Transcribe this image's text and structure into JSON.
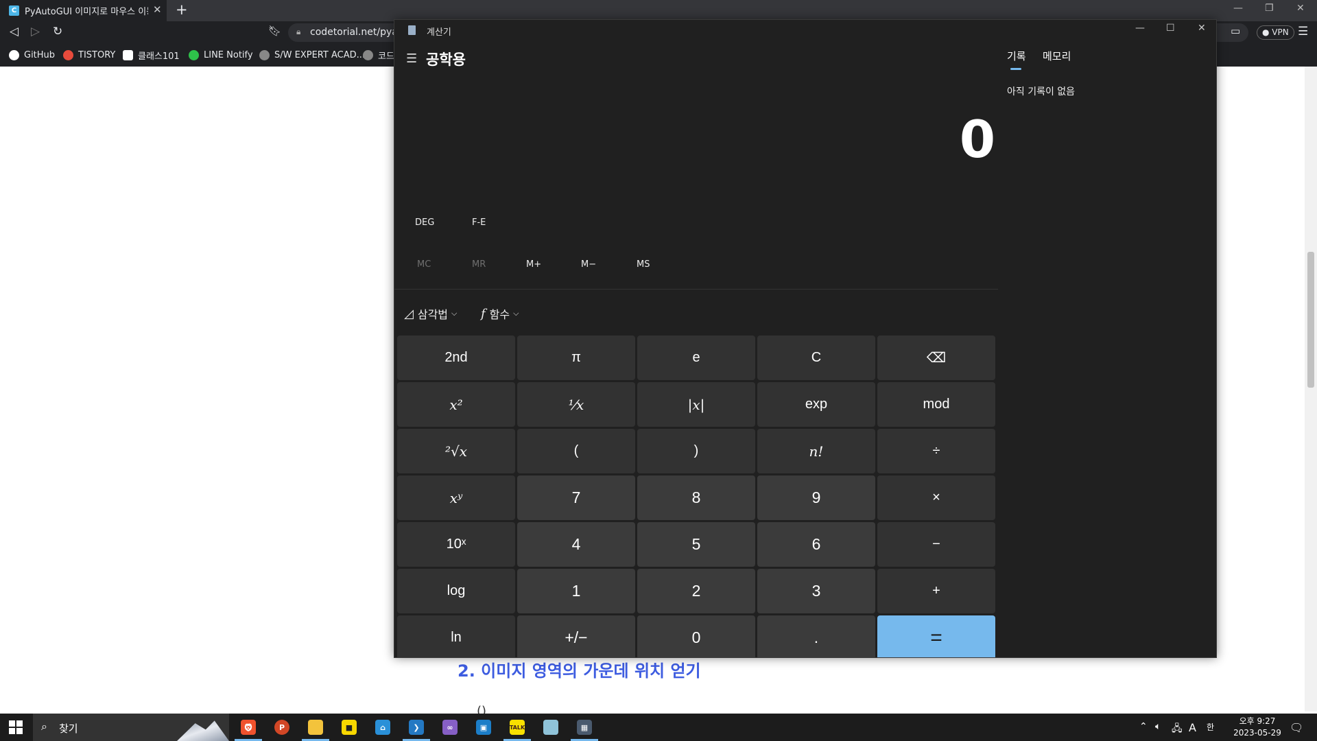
{
  "browser": {
    "tab_title": "PyAutoGUI 이미지로 마우스 이동",
    "tab_favicon": "C",
    "url": "codetorial.net/pyau",
    "vpn_label": "VPN",
    "bookmarks": [
      "GitHub",
      "TISTORY",
      "클래스101",
      "LINE Notify",
      "S/W EXPERT ACAD...",
      "코드"
    ]
  },
  "page": {
    "heading": "2. 이미지 영역의 가운데 위치 얻기",
    "code_fragment": "()"
  },
  "calculator": {
    "window_title": "계산기",
    "mode": "공학용",
    "display": "0",
    "angle_mode": "DEG",
    "fe_label": "F-E",
    "memory": {
      "mc": "MC",
      "mr": "MR",
      "mplus": "M+",
      "mminus": "M−",
      "ms": "MS"
    },
    "trig_label": "삼각법",
    "func_label": "함수",
    "history_tab": "기록",
    "memory_tab": "메모리",
    "history_empty": "아직 기록이 없음",
    "keys": {
      "second": "2nd",
      "pi": "π",
      "e": "e",
      "clear": "C",
      "x_squared": "x²",
      "reciprocal": "¹⁄x",
      "abs": "|x|",
      "exp": "exp",
      "mod": "mod",
      "sqrt": "²√x",
      "lparen": "(",
      "rparen": ")",
      "factorial": "n!",
      "divide": "÷",
      "x_pow_y": "xʸ",
      "seven": "7",
      "eight": "8",
      "nine": "9",
      "multiply": "×",
      "ten_pow": "10ˣ",
      "four": "4",
      "five": "5",
      "six": "6",
      "minus": "−",
      "log": "log",
      "one": "1",
      "two": "2",
      "three": "3",
      "plus": "+",
      "ln": "ln",
      "negate": "+/−",
      "zero": "0",
      "decimal": ".",
      "equals": "="
    }
  },
  "taskbar": {
    "search_placeholder": "찾기",
    "clock_time": "오후 9:27",
    "clock_date": "2023-05-29",
    "ime": "A",
    "lang": "한"
  },
  "colors": {
    "accent": "#76b9ed",
    "calc_bg": "#202020",
    "link_heading": "#3d5ce0"
  }
}
